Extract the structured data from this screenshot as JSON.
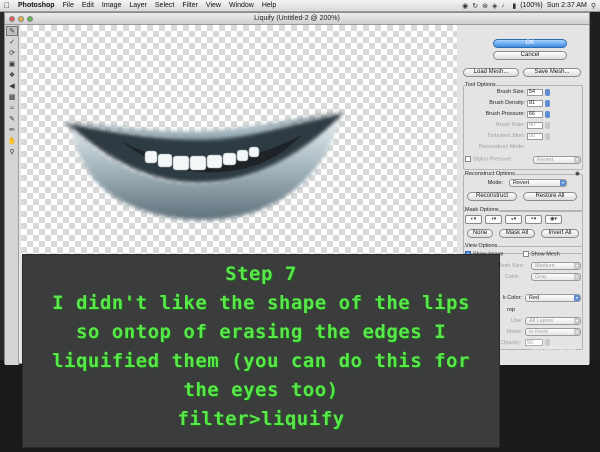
{
  "menubar": {
    "app": "Photoshop",
    "items": [
      "File",
      "Edit",
      "Image",
      "Layer",
      "Select",
      "Filter",
      "View",
      "Window",
      "Help"
    ],
    "battery": "(100%)",
    "clock": "Sun 2:37 AM"
  },
  "window": {
    "title": "Liquify (Untitled-2 @ 200%)"
  },
  "panel": {
    "ok_label": "OK",
    "cancel_label": "Cancel",
    "load_mesh_label": "Load Mesh...",
    "save_mesh_label": "Save Mesh...",
    "tool_options": {
      "title": "Tool Options",
      "brush_size_label": "Brush Size:",
      "brush_size": "54",
      "brush_density_label": "Brush Density:",
      "brush_density": "81",
      "brush_pressure_label": "Brush Pressure:",
      "brush_pressure": "66",
      "brush_rate_label": "Brush Rate:",
      "brush_rate": "40",
      "turbulent_jitter_label": "Turbulent Jitter:",
      "turbulent_jitter": "50",
      "reconstruct_mode_label": "Reconstruct Mode:",
      "reconstruct_mode": "Revert",
      "stylus_pressure_label": "Stylus Pressure"
    },
    "reconstruct_options": {
      "title": "Reconstruct Options",
      "mode_label": "Mode:",
      "mode": "Revert",
      "reconstruct_label": "Reconstruct",
      "restore_all_label": "Restore All"
    },
    "mask_options": {
      "title": "Mask Options",
      "none_label": "None",
      "mask_all_label": "Mask All",
      "invert_all_label": "Invert All"
    },
    "view_options": {
      "title": "View Options",
      "show_image_label": "Show Image",
      "show_mesh_label": "Show Mesh",
      "mesh_size_label": "Mesh Size:",
      "mesh_size": "Medium",
      "mesh_color_label": "Color:",
      "mesh_color": "Gray",
      "mask_color_label": "k Color:",
      "mask_color": "Red",
      "backdrop_label": "rop",
      "use_label": "Use:",
      "use": "All Layers",
      "mode_label": "Mode:",
      "mode": "In Front",
      "opacity_label": "Opacity:",
      "opacity": "50"
    }
  },
  "source_label": "sourceimage.jpg",
  "caption": {
    "lines": [
      "Step 7",
      "I didn't like the shape of the lips",
      "so ontop of erasing the edges I",
      "liquified them (you can do this for",
      "the eyes too)",
      "filter>liquify"
    ],
    "color": "#58e84a",
    "background": "#3b3d3c"
  }
}
